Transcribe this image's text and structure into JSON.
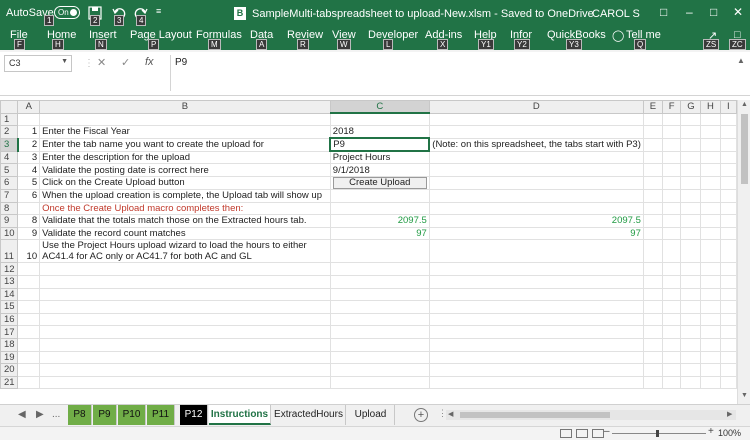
{
  "titlebar": {
    "autosave_label": "AutoSave",
    "autosave_state": "On",
    "doc_badge": "B",
    "doc_title": "SampleMulti-tabspreadsheet to upload-New.xlsm  -  Saved to OneDrive",
    "user_name": "CAROL S",
    "keytips": [
      "1",
      "2",
      "3",
      "4"
    ]
  },
  "ribbon": {
    "tabs": [
      {
        "label": "File",
        "key": "F"
      },
      {
        "label": "Home",
        "key": "H"
      },
      {
        "label": "Insert",
        "key": "N"
      },
      {
        "label": "Page Layout",
        "key": "P"
      },
      {
        "label": "Formulas",
        "key": "M"
      },
      {
        "label": "Data",
        "key": "A"
      },
      {
        "label": "Review",
        "key": "R"
      },
      {
        "label": "View",
        "key": "W"
      },
      {
        "label": "Developer",
        "key": "L"
      },
      {
        "label": "Add-ins",
        "key": "X"
      },
      {
        "label": "Help",
        "key": "Y1"
      },
      {
        "label": "Infor",
        "key": "Y2"
      },
      {
        "label": "QuickBooks",
        "key": "Y3"
      },
      {
        "label": "Tell me",
        "key": "Q"
      }
    ],
    "right_keys": [
      "ZS",
      "ZC"
    ]
  },
  "formula_bar": {
    "name_box": "C3",
    "fx": "fx",
    "value": "P9"
  },
  "columns": [
    "A",
    "B",
    "C",
    "D",
    "E",
    "F",
    "G",
    "H",
    "I"
  ],
  "selected_column": "C",
  "rows": [
    {
      "n": "1",
      "a": "",
      "b": "",
      "c": "",
      "d": "",
      "e": ""
    },
    {
      "n": "2",
      "a": "1",
      "b": "Enter the Fiscal Year",
      "c": "2018",
      "d": "",
      "e": ""
    },
    {
      "n": "3",
      "a": "2",
      "b": "Enter the tab name you want to create the upload for",
      "c": "P9",
      "d": "(Note: on this spreadsheet, the tabs start with P3)",
      "e": ""
    },
    {
      "n": "4",
      "a": "3",
      "b": "Enter the description for the upload",
      "c": "Project Hours",
      "d": "",
      "e": ""
    },
    {
      "n": "5",
      "a": "4",
      "b": "Validate the posting date is correct here",
      "c": "9/1/2018",
      "d": "",
      "e": ""
    },
    {
      "n": "6",
      "a": "5",
      "b": "Click on the Create Upload button",
      "c": "",
      "d": "",
      "e": ""
    },
    {
      "n": "7",
      "a": "6",
      "b": "When the upload creation is complete, the Upload tab will show up",
      "c": "",
      "d": "",
      "e": ""
    },
    {
      "n": "8",
      "a": "",
      "b": "Once the Create Upload macro completes then:",
      "c": "",
      "d": "",
      "e": ""
    },
    {
      "n": "9",
      "a": "8",
      "b": "Validate that the totals match those on the Extracted hours tab.",
      "c": "2097.5",
      "d": "2097.5",
      "e": ""
    },
    {
      "n": "10",
      "a": "9",
      "b": "Validate the record count matches",
      "c": "97",
      "d": "97",
      "e": ""
    },
    {
      "n": "11",
      "a": "10",
      "b": "Use the Project Hours upload wizard to load the hours to either AC41.4 for AC only or AC41.7 for both AC and GL",
      "c": "",
      "d": "",
      "e": ""
    },
    {
      "n": "12"
    },
    {
      "n": "13"
    },
    {
      "n": "14"
    },
    {
      "n": "15"
    },
    {
      "n": "16"
    },
    {
      "n": "17"
    },
    {
      "n": "18"
    },
    {
      "n": "19"
    },
    {
      "n": "20"
    },
    {
      "n": "21"
    }
  ],
  "create_upload_button": "Create Upload",
  "sheet_tabs": {
    "more": "...",
    "tabs": [
      {
        "label": "P8",
        "style": "green"
      },
      {
        "label": "P9",
        "style": "green"
      },
      {
        "label": "P10",
        "style": "green"
      },
      {
        "label": "P11",
        "style": "green"
      },
      {
        "label": "P12",
        "style": "black"
      },
      {
        "label": "Instructions",
        "style": "active"
      },
      {
        "label": "ExtractedHours",
        "style": "plain"
      },
      {
        "label": "Upload",
        "style": "plain"
      }
    ],
    "add_label": "+"
  },
  "status": {
    "zoom": "100%"
  },
  "colors": {
    "accent": "#217346",
    "tab_green": "#70ad47",
    "value_green": "#1f9a42",
    "note_red": "#c0392b"
  }
}
